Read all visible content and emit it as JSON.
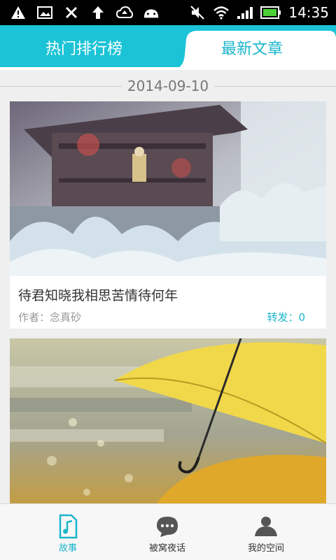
{
  "status_bar": {
    "time": "14:35",
    "icons": [
      "warning-icon",
      "image-icon",
      "tools-icon",
      "upload-arrow-icon",
      "cloud-upload-icon",
      "android-icon",
      "mute-icon",
      "wifi-icon",
      "signal-icon",
      "battery-icon"
    ]
  },
  "tabs": {
    "items": [
      {
        "label": "热门排行榜",
        "active": false
      },
      {
        "label": "最新文章",
        "active": true
      }
    ],
    "accent": "#1bc3d6"
  },
  "feed": {
    "date": "2014-09-10",
    "articles": [
      {
        "title": "待君知晓我相思苦情待何年",
        "author": "作者：念真砂",
        "share": "转发：0",
        "image": "ancient-pavilion-snow-image"
      },
      {
        "image": "yellow-umbrella-rain-image"
      }
    ]
  },
  "bottom_nav": {
    "items": [
      {
        "label": "故事",
        "icon": "music-note-file-icon",
        "active": true
      },
      {
        "label": "被窝夜话",
        "icon": "chat-bubble-icon",
        "active": false
      },
      {
        "label": "我的空间",
        "icon": "person-icon",
        "active": false
      }
    ]
  }
}
